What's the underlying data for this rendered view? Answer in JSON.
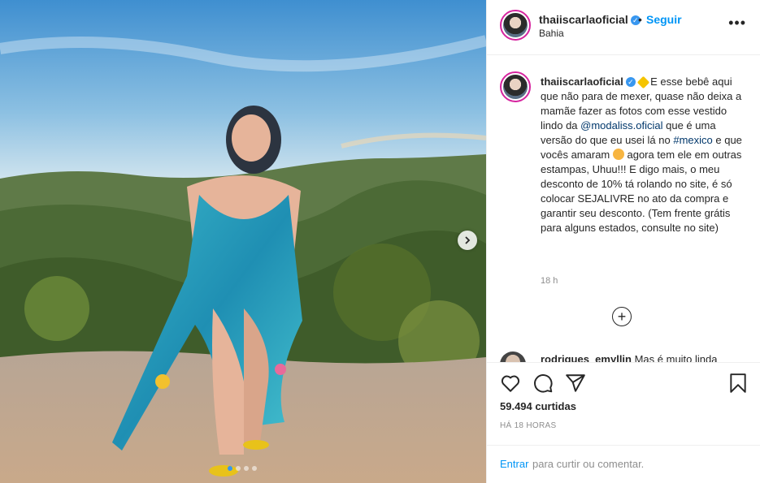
{
  "post": {
    "username": "thaiiscarlaoficial",
    "verified_glyph": "✓",
    "separator": "•",
    "follow_label": "Seguir",
    "location": "Bahia",
    "more_icon": "more-horizontal-icon",
    "more_glyph": "•••"
  },
  "media": {
    "slide_count": 4,
    "active_slide": 1,
    "next_icon": "chevron-right-icon",
    "next_glyph": "›"
  },
  "caption": {
    "username": "thaiiscarlaoficial",
    "part1": " E esse bebê aqui que não para de mexer, quase não deixa a mamãe fazer as fotos com esse vestido lindo da ",
    "mention": "@modaliss.oficial",
    "part2": " que é uma versão do que eu usei lá no ",
    "hashtag": "#mexico",
    "part3": " e que vocês amaram ",
    "part4": " agora tem ele em outras estampas, Uhuu!!! E digo mais, o meu desconto de 10% tá rolando no site, é só colocar SEJALIVRE no ato da compra e garantir seu desconto. (Tem frente grátis para alguns estados, consulte no site)",
    "emoji_1": "sparkles-icon",
    "emoji_2": "smiling-face-icon",
    "time": "18 h"
  },
  "comments": {
    "load_more_glyph": "+",
    "second": {
      "username": "rodrigues_emyllin",
      "text": " Mas é muito linda"
    }
  },
  "actions": {
    "likes": "59.494 curtidas",
    "posted": "HÁ 18 HORAS"
  },
  "login": {
    "link": "Entrar",
    "text": " para curtir ou comentar."
  },
  "colors": {
    "accent": "#0095f6",
    "verified": "#3897f0",
    "text": "#262626",
    "muted": "#8e8e8e"
  }
}
